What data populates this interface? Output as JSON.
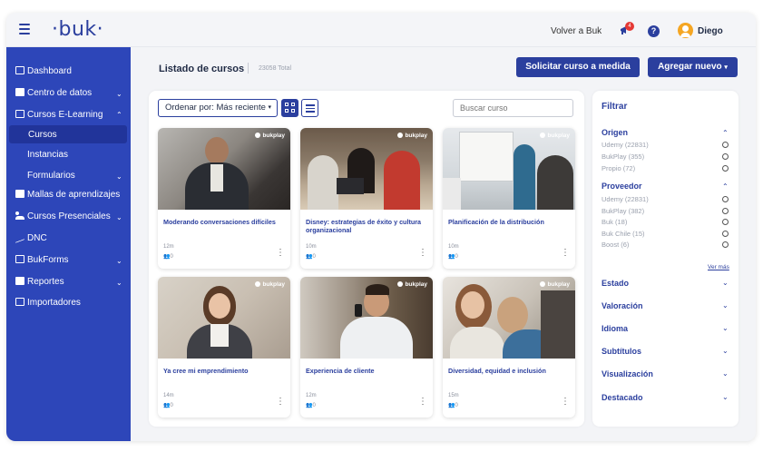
{
  "header": {
    "logo": "·buk·",
    "volver": "Volver a Buk",
    "notif_count": "4",
    "help": "?",
    "user": "Diego"
  },
  "sidebar": {
    "items": [
      {
        "label": "Dashboard",
        "icon": "dashboard-icon",
        "expandable": false
      },
      {
        "label": "Centro de datos",
        "icon": "database-icon",
        "expandable": true
      },
      {
        "label": "Cursos E-Learning",
        "icon": "elearning-icon",
        "expandable": true,
        "expanded": true
      },
      {
        "label": "Mallas de aprendizajes",
        "icon": "file-icon",
        "expandable": false
      },
      {
        "label": "Cursos Presenciales",
        "icon": "people-icon",
        "expandable": true
      },
      {
        "label": "DNC",
        "icon": "trend-icon",
        "expandable": false
      },
      {
        "label": "BukForms",
        "icon": "form-icon",
        "expandable": true
      },
      {
        "label": "Reportes",
        "icon": "report-icon",
        "expandable": true
      },
      {
        "label": "Importadores",
        "icon": "import-icon",
        "expandable": false
      }
    ],
    "sub_items": [
      "Cursos",
      "Instancias",
      "Formularios"
    ],
    "active_sub": "Cursos"
  },
  "main": {
    "title": "Listado de cursos",
    "total": "23058 Total",
    "btn_request": "Solicitar curso a medida",
    "btn_add": "Agregar nuevo",
    "sort_label": "Ordenar por: Más reciente",
    "search_placeholder": "Buscar curso"
  },
  "courses": [
    {
      "title": "Moderando conversaciones difíciles",
      "duration": "12m",
      "enrolled": "0",
      "provider_badge": "bukplay"
    },
    {
      "title": "Disney: estrategias de éxito y cultura organizacional",
      "duration": "10m",
      "enrolled": "0",
      "provider_badge": "bukplay"
    },
    {
      "title": "Planificación de la distribución",
      "duration": "10m",
      "enrolled": "0",
      "provider_badge": "bukplay"
    },
    {
      "title": "Ya cree mi emprendimiento",
      "duration": "14m",
      "enrolled": "0",
      "provider_badge": "bukplay"
    },
    {
      "title": "Experiencia de cliente",
      "duration": "12m",
      "enrolled": "0",
      "provider_badge": "bukplay"
    },
    {
      "title": "Diversidad, equidad e inclusión",
      "duration": "15m",
      "enrolled": "0",
      "provider_badge": "bukplay"
    }
  ],
  "filter": {
    "title": "Filtrar",
    "origen": {
      "label": "Origen",
      "options": [
        "Udemy (22831)",
        "BukPlay (355)",
        "Propio (72)"
      ]
    },
    "proveedor": {
      "label": "Proveedor",
      "options": [
        "Udemy (22831)",
        "BukPlay (382)",
        "Buk (18)",
        "Buk Chile (15)",
        "Boost (6)"
      ],
      "more": "Ver más"
    },
    "sections": [
      "Estado",
      "Valoración",
      "Idioma",
      "Subtítulos",
      "Visualización",
      "Destacado"
    ]
  },
  "colors": {
    "primary": "#2b3f9e",
    "sidebar": "#2d46b9",
    "badge": "#e53935",
    "avatar": "#f5a623"
  }
}
